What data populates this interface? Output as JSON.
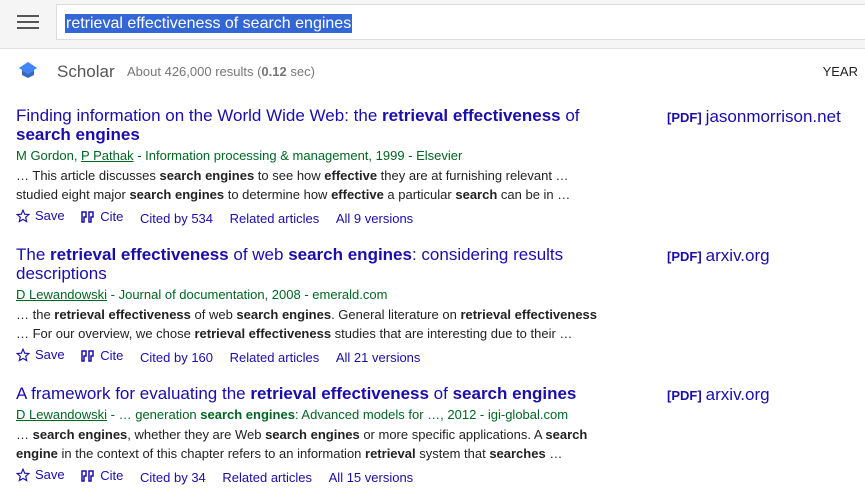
{
  "search": {
    "query": "retrieval effectiveness of search engines"
  },
  "header": {
    "app_name": "Scholar",
    "stats_prefix": "About 426,000 results (",
    "stats_time": "0.12",
    "stats_suffix": " sec)",
    "year_label": "YEAR"
  },
  "results": [
    {
      "title": [
        {
          "t": "Finding information on the World Wide Web: the ",
          "b": false
        },
        {
          "t": "retrieval effectiveness",
          "b": true
        },
        {
          "t": " of ",
          "b": false
        },
        {
          "t": "search engines",
          "b": true
        }
      ],
      "meta": [
        {
          "t": "M Gordon",
          "link": false
        },
        {
          "t": ", ",
          "link": false
        },
        {
          "t": "P Pathak",
          "link": true
        },
        {
          "t": " - Information processing & management, 1999 - Elsevier",
          "link": false
        }
      ],
      "snippet": [
        {
          "t": "… This article discusses ",
          "b": false
        },
        {
          "t": "search engines",
          "b": true
        },
        {
          "t": " to see how ",
          "b": false
        },
        {
          "t": "effective",
          "b": true
        },
        {
          "t": " they are at furnishing relevant … studied eight major ",
          "b": false
        },
        {
          "t": "search engines",
          "b": true
        },
        {
          "t": " to determine how ",
          "b": false
        },
        {
          "t": "effective",
          "b": true
        },
        {
          "t": " a particular ",
          "b": false
        },
        {
          "t": "search",
          "b": true
        },
        {
          "t": " can be in …",
          "b": false
        }
      ],
      "actions": {
        "save": "Save",
        "cite": "Cite",
        "cited_by": "Cited by 534",
        "related": "Related articles",
        "versions": "All 9 versions"
      },
      "side": {
        "format": "[PDF]",
        "source": "jasonmorrison.net"
      }
    },
    {
      "title": [
        {
          "t": "The ",
          "b": false
        },
        {
          "t": "retrieval effectiveness",
          "b": true
        },
        {
          "t": " of web ",
          "b": false
        },
        {
          "t": "search engines",
          "b": true
        },
        {
          "t": ": considering results descriptions",
          "b": false
        }
      ],
      "meta": [
        {
          "t": "D Lewandowski",
          "link": true
        },
        {
          "t": " - Journal of documentation, 2008 - emerald.com",
          "link": false
        }
      ],
      "snippet": [
        {
          "t": "… the ",
          "b": false
        },
        {
          "t": "retrieval effectiveness",
          "b": true
        },
        {
          "t": " of web ",
          "b": false
        },
        {
          "t": "search engines",
          "b": true
        },
        {
          "t": ". General literature on ",
          "b": false
        },
        {
          "t": "retrieval effectiveness",
          "b": true
        },
        {
          "t": " … For our overview, we chose ",
          "b": false
        },
        {
          "t": "retrieval effectiveness",
          "b": true
        },
        {
          "t": " studies that are interesting due to their …",
          "b": false
        }
      ],
      "actions": {
        "save": "Save",
        "cite": "Cite",
        "cited_by": "Cited by 160",
        "related": "Related articles",
        "versions": "All 21 versions"
      },
      "side": {
        "format": "[PDF]",
        "source": "arxiv.org"
      }
    },
    {
      "title": [
        {
          "t": "A framework for evaluating the ",
          "b": false
        },
        {
          "t": "retrieval effectiveness",
          "b": true
        },
        {
          "t": " of ",
          "b": false
        },
        {
          "t": "search engines",
          "b": true
        }
      ],
      "meta": [
        {
          "t": "D Lewandowski",
          "link": true
        },
        {
          "t": " - … generation ",
          "link": false
        },
        {
          "t": "search engines",
          "link": false,
          "b": true
        },
        {
          "t": ": Advanced models for …, 2012 - igi-global.com",
          "link": false
        }
      ],
      "snippet": [
        {
          "t": "… ",
          "b": false
        },
        {
          "t": "search engines",
          "b": true
        },
        {
          "t": ", whether they are Web ",
          "b": false
        },
        {
          "t": "search engines",
          "b": true
        },
        {
          "t": " or more specific applications. A ",
          "b": false
        },
        {
          "t": "search engine",
          "b": true
        },
        {
          "t": " in the context of this chapter refers to an information ",
          "b": false
        },
        {
          "t": "retrieval",
          "b": true
        },
        {
          "t": " system that ",
          "b": false
        },
        {
          "t": "searches",
          "b": true
        },
        {
          "t": " …",
          "b": false
        }
      ],
      "actions": {
        "save": "Save",
        "cite": "Cite",
        "cited_by": "Cited by 34",
        "related": "Related articles",
        "versions": "All 15 versions"
      },
      "side": {
        "format": "[PDF]",
        "source": "arxiv.org"
      }
    }
  ],
  "icons": {
    "menu": "hamburger-icon",
    "logo": "scholar-cap-icon",
    "save": "star-outline-icon",
    "cite": "quote-icon"
  },
  "colors": {
    "link": "#1a0dab",
    "meta": "#006621",
    "selection": "#3367d6",
    "logo": "#4285f4"
  }
}
